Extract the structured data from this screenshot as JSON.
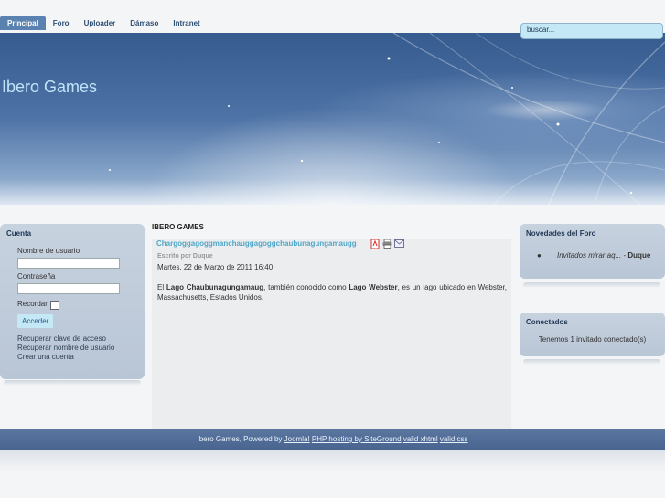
{
  "nav": {
    "items": [
      "Principal",
      "Foro",
      "Uploader",
      "Dámaso",
      "Intranet"
    ],
    "active": "Principal"
  },
  "search": {
    "placeholder": "buscar..."
  },
  "site": {
    "title": "Ibero Games"
  },
  "login": {
    "title": "Cuenta",
    "username_label": "Nombre de usuario",
    "password_label": "Contraseña",
    "remember_label": "Recordar",
    "submit_label": "Acceder",
    "links": [
      "Recuperar clave de acceso",
      "Recuperar nombre de usuario",
      "Crear una cuenta"
    ]
  },
  "main": {
    "heading": "IBERO GAMES",
    "article": {
      "title": "Chargoggagoggmanchauggagoggchaubunagungamaugg",
      "author": "Escrito por Duque",
      "date": "Martes, 22 de Marzo de 2011 16:40",
      "p_pre": "El",
      "p_bold1": "Lago Chaubunagungamaug",
      "p_mid": ", también conocido como",
      "p_bold2": "Lago Webster",
      "p_post": ", es un lago ubicado en Webster, Massachusetts, Estados Unidos."
    }
  },
  "forum": {
    "title": "Novedades del Foro",
    "item_text": "Invitados mirar aq...",
    "item_sep": "-",
    "item_author": "Duque"
  },
  "online": {
    "title": "Conectados",
    "text": "Tenemos 1 invitado conectado(s)"
  },
  "footer": {
    "prefix": "Ibero Games, Powered by",
    "links": [
      "Joomla!",
      "PHP hosting by SiteGround",
      "valid xhtml",
      "valid css"
    ]
  },
  "colors": {
    "accent": "#4fa6c6",
    "nav_active": "#5a82b1",
    "footer": "#526e98"
  }
}
